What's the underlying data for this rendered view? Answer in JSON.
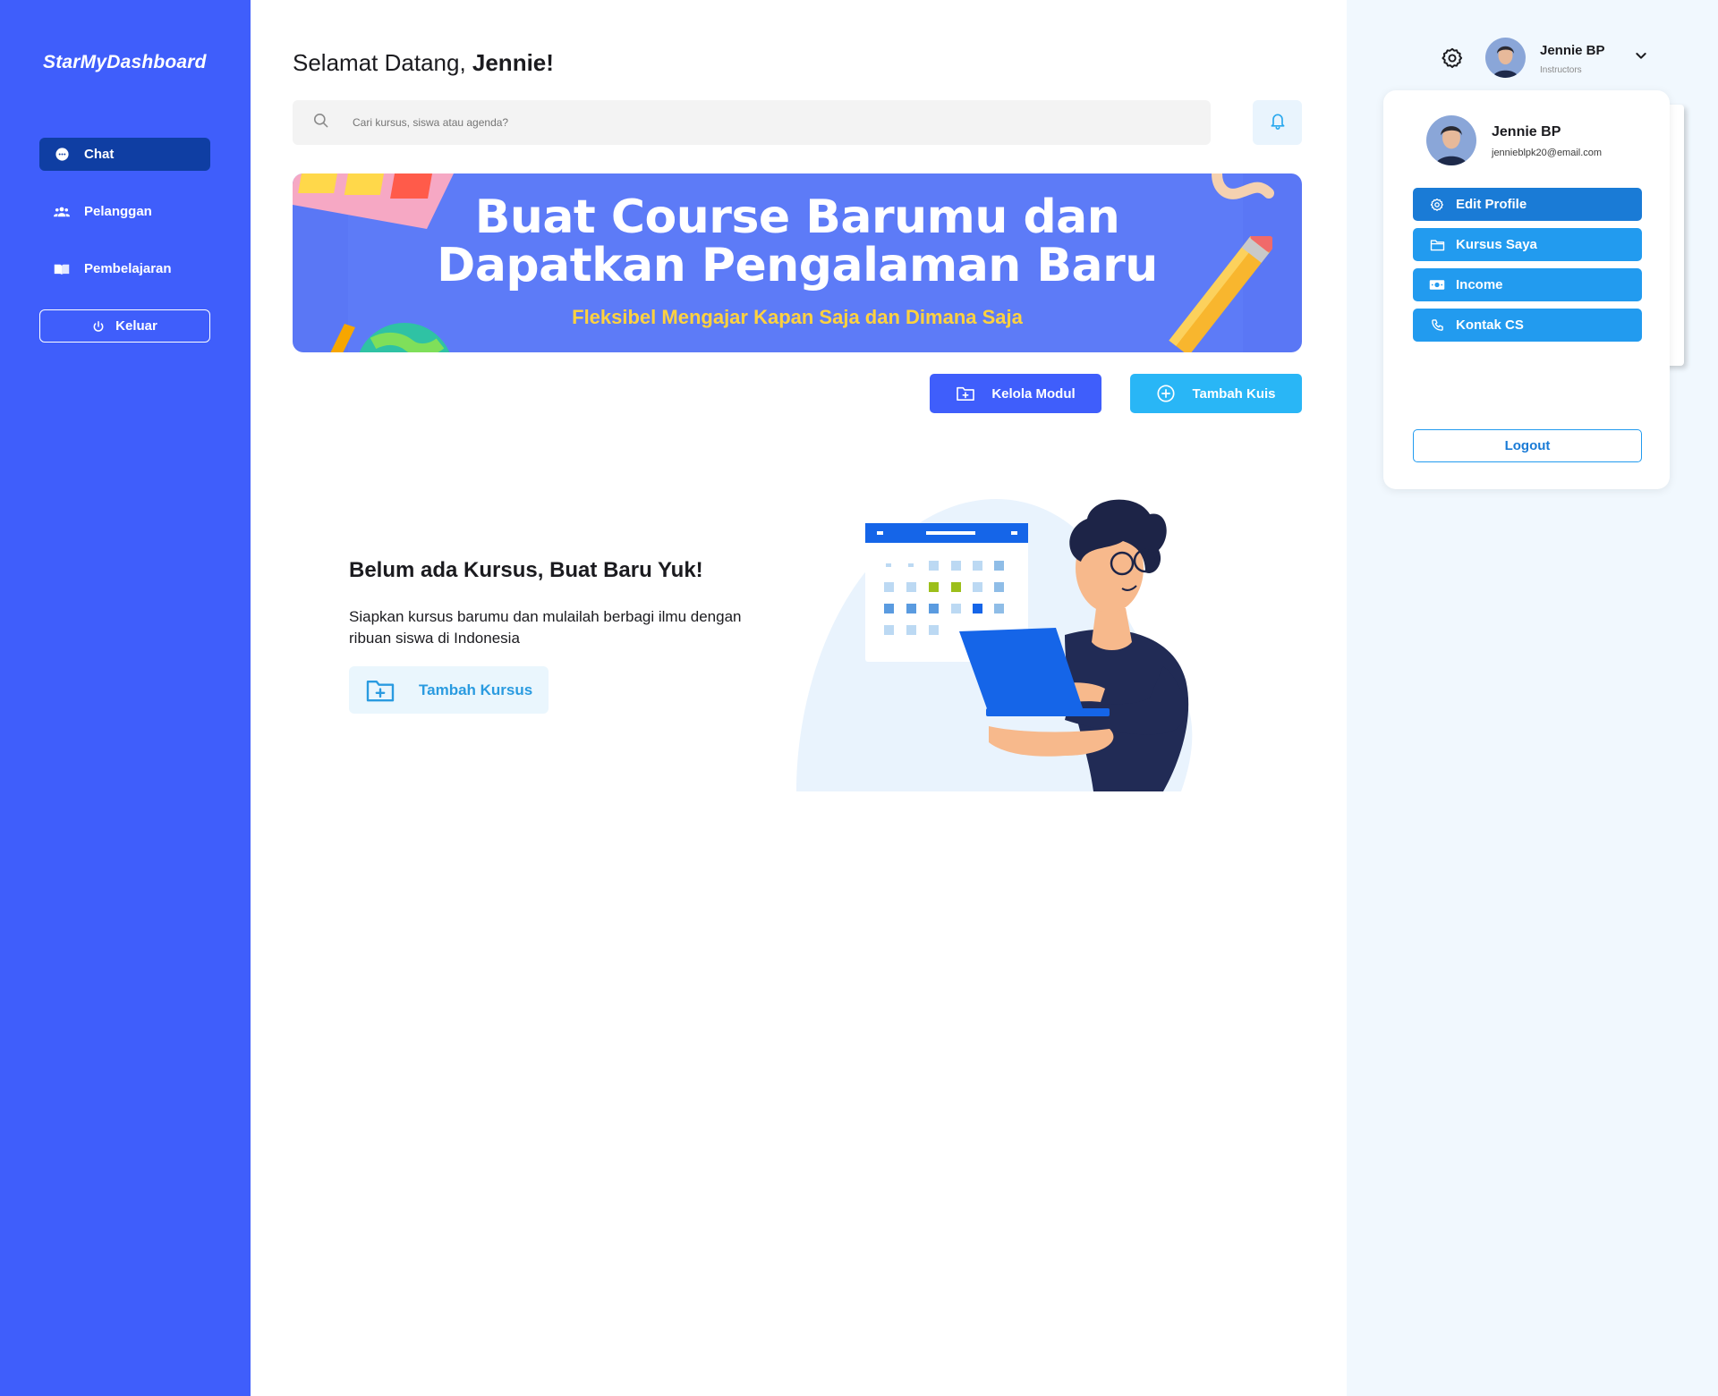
{
  "brand": "StarMyDashboard",
  "sidebar": {
    "items": [
      {
        "label": "Chat",
        "icon": "chat-bubble-icon",
        "active": true
      },
      {
        "label": "Pelanggan",
        "icon": "users-icon",
        "active": false
      },
      {
        "label": "Pembelajaran",
        "icon": "book-icon",
        "active": false
      }
    ],
    "logout_label": "Keluar"
  },
  "header": {
    "greeting_prefix": "Selamat Datang, ",
    "greeting_name": "Jennie!"
  },
  "search": {
    "placeholder": "Cari kursus, siswa atau agenda?"
  },
  "banner": {
    "title_line1": "Buat Course Barumu dan",
    "title_line2": "Dapatkan Pengalaman Baru",
    "subtitle": "Fleksibel Mengajar Kapan Saja dan Dimana Saja"
  },
  "actions": {
    "kelola_modul": "Kelola Modul",
    "tambah_kuis": "Tambah Kuis"
  },
  "empty_state": {
    "title": "Belum ada Kursus, Buat Baru Yuk!",
    "description": "Siapkan kursus barumu dan mulailah berbagi ilmu dengan ribuan siswa di Indonesia",
    "button_label": "Tambah Kursus"
  },
  "user": {
    "name": "Jennie BP",
    "role": "Instructors",
    "email": "jennieblpk20@email.com"
  },
  "dropdown": {
    "items": [
      {
        "label": "Edit Profile",
        "icon": "gear-icon"
      },
      {
        "label": "Kursus Saya",
        "icon": "folder-icon"
      },
      {
        "label": "Income",
        "icon": "money-icon"
      },
      {
        "label": "Kontak CS",
        "icon": "phone-icon"
      }
    ],
    "logout_label": "Logout"
  },
  "colors": {
    "sidebar": "#3f5efb",
    "active_nav": "#0f3ea3",
    "banner": "#5a77f5",
    "banner_subtitle": "#ffd23f",
    "accent_blue": "#229bef",
    "right_panel": "#f1f8fe"
  }
}
